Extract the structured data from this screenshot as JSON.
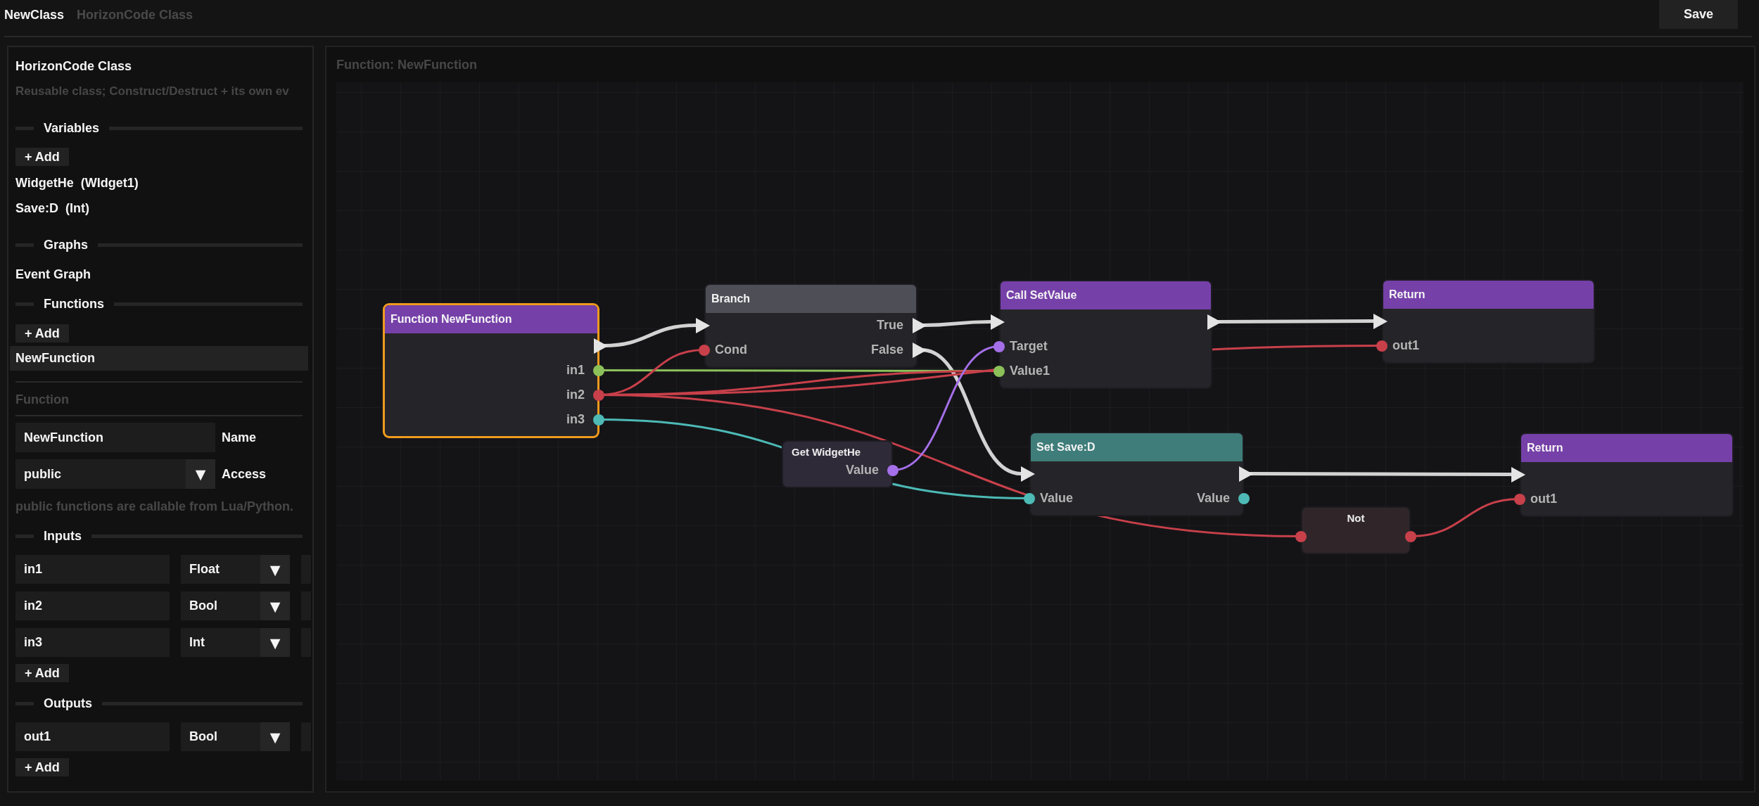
{
  "header": {
    "title": "NewClass",
    "subtitle": "HorizonCode Class",
    "save_button": "Save"
  },
  "sidebar": {
    "title": "HorizonCode Class",
    "description": "Reusable class; Construct/Destruct + its own ev",
    "variables": {
      "heading": "Variables",
      "add_button": "+ Add",
      "items": [
        {
          "name": "WidgetHe",
          "type": "(WIdget1)"
        },
        {
          "name": "Save:D",
          "type": "(Int)"
        }
      ]
    },
    "graphs": {
      "heading": "Graphs",
      "items": [
        {
          "label": "Event Graph",
          "selected": false
        }
      ]
    },
    "functions": {
      "heading": "Functions",
      "add_button": "+ Add",
      "items": [
        {
          "label": "NewFunction",
          "selected": true
        }
      ]
    },
    "details": {
      "heading": "Function",
      "name_field": {
        "value": "NewFunction",
        "label": "Name"
      },
      "access_field": {
        "value": "public",
        "caret": "▼",
        "label": "Access"
      },
      "hint": "public functions are callable from Lua/Python.",
      "inputs": {
        "heading": "Inputs",
        "rows": [
          {
            "name": "in1",
            "type": "Float",
            "caret": "▼"
          },
          {
            "name": "in2",
            "type": "Bool",
            "caret": "▼"
          },
          {
            "name": "in3",
            "type": "Int",
            "caret": "▼"
          }
        ],
        "add_button": "+ Add"
      },
      "outputs": {
        "heading": "Outputs",
        "rows": [
          {
            "name": "out1",
            "type": "Bool",
            "caret": "▼"
          }
        ],
        "add_button": "+ Add"
      }
    }
  },
  "graph": {
    "title": "Function: NewFunction",
    "nodes": [
      {
        "title": "Function NewFunction",
        "kind": "full",
        "color": "#7640a9",
        "selected": true,
        "outputs": [
          {
            "kind": "exec"
          },
          {
            "kind": "data",
            "label": "in1",
            "color": "#8cc15a"
          },
          {
            "kind": "data",
            "label": "in2",
            "color": "#c8404a"
          },
          {
            "kind": "data",
            "label": "in3",
            "color": "#4dbab6"
          }
        ]
      },
      {
        "title": "Branch",
        "kind": "full",
        "color": "#4e4e56",
        "selected": false,
        "inputs": [
          {
            "kind": "exec"
          },
          {
            "kind": "data",
            "label": "Cond",
            "color": "#c8404a"
          }
        ],
        "outputs": [
          {
            "kind": "exec",
            "label": "True"
          },
          {
            "kind": "exec",
            "label": "False"
          }
        ]
      },
      {
        "title": "Call SetValue",
        "kind": "full",
        "color": "#7640a9",
        "selected": false,
        "inputs": [
          {
            "kind": "exec"
          },
          {
            "kind": "data",
            "label": "Target",
            "color": "#a46fe8"
          },
          {
            "kind": "data",
            "label": "Value1",
            "color": "#8cc15a"
          }
        ],
        "outputs": [
          {
            "kind": "exec"
          }
        ]
      },
      {
        "title": "Return",
        "kind": "full",
        "color": "#7640a9",
        "selected": false,
        "inputs": [
          {
            "kind": "exec"
          },
          {
            "kind": "data",
            "label": "out1",
            "color": "#c8404a"
          }
        ]
      },
      {
        "title": "Get WidgetHe",
        "kind": "getter",
        "color": "#2e2a38",
        "selected": false,
        "outputs": [
          {
            "kind": "data",
            "label": "Value",
            "color": "#a46fe8"
          }
        ]
      },
      {
        "title": "Set Save:D",
        "kind": "full",
        "color": "#3f7d7a",
        "selected": false,
        "inputs": [
          {
            "kind": "exec"
          },
          {
            "kind": "data",
            "label": "Value",
            "color": "#4dbab6"
          }
        ],
        "outputs": [
          {
            "kind": "exec"
          },
          {
            "kind": "data",
            "label": "Value",
            "color": "#4dbab6"
          }
        ]
      },
      {
        "title": "Return",
        "kind": "full",
        "color": "#7640a9",
        "selected": false,
        "inputs": [
          {
            "kind": "exec"
          },
          {
            "kind": "data",
            "label": "out1",
            "color": "#c8404a"
          }
        ]
      },
      {
        "title": "Not",
        "kind": "operator",
        "color": "#30262a",
        "selected": false,
        "inputs": [
          {
            "kind": "data",
            "color": "#c8404a"
          }
        ],
        "outputs": [
          {
            "kind": "data",
            "color": "#c8404a"
          }
        ]
      }
    ]
  }
}
